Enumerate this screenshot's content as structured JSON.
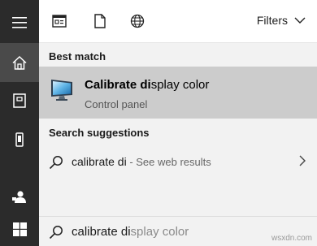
{
  "rail": {
    "items": [
      {
        "name": "hamburger-menu"
      },
      {
        "name": "home"
      },
      {
        "name": "documents"
      },
      {
        "name": "device"
      },
      {
        "name": "feedback"
      },
      {
        "name": "start"
      }
    ]
  },
  "topbar": {
    "scopes": [
      "apps",
      "documents",
      "web"
    ],
    "filters_label": "Filters"
  },
  "results": {
    "best_match_header": "Best match",
    "best_match": {
      "title_bold": "Calibrate di",
      "title_rest": "splay color",
      "subtitle": "Control panel",
      "icon": "monitor-icon"
    },
    "suggestions_header": "Search suggestions",
    "suggestion": {
      "query": "calibrate di",
      "hint": " - See web results"
    }
  },
  "searchbox": {
    "typed": "calibrate di",
    "autocomplete": "splay color"
  },
  "watermark": "wsxdn.com",
  "colors": {
    "rail": "#2b2b2b",
    "rail_active": "#4a4a4a",
    "selected": "#cccccc",
    "panel": "#f2f2f2"
  }
}
